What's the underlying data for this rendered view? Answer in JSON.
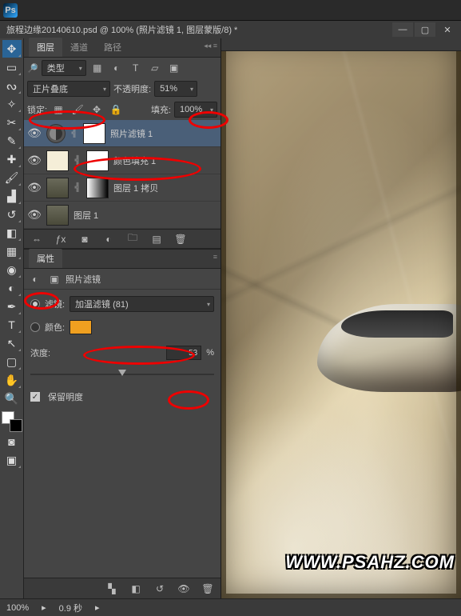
{
  "app": {
    "logo_text": "Ps"
  },
  "titlebar": {
    "text": "旅程边缘20140610.psd @ 100% (照片滤镜 1, 图层蒙版/8) *",
    "min": "—",
    "max": "▢",
    "close": "✕"
  },
  "tools": [
    "move",
    "marquee",
    "lasso",
    "wand",
    "crop",
    "eyedropper",
    "heal",
    "brush",
    "stamp",
    "history",
    "eraser",
    "gradient",
    "blur",
    "dodge",
    "pen",
    "type",
    "path",
    "rect",
    "hand",
    "zoom"
  ],
  "panels": {
    "layersTabs": {
      "t1": "图层",
      "t2": "通道",
      "t3": "路径"
    },
    "kind": {
      "label": "类型"
    },
    "blend": {
      "mode": "正片叠底",
      "opacityLabel": "不透明度:",
      "opacity": "51%"
    },
    "lock": {
      "label": "锁定:",
      "fillLabel": "填充:",
      "fill": "100%"
    },
    "layers": [
      {
        "name": "照片滤镜 1",
        "selected": true,
        "type": "adj"
      },
      {
        "name": "颜色填充 1",
        "type": "fill"
      },
      {
        "name": "图层 1 拷贝",
        "type": "img"
      },
      {
        "name": "图层 1",
        "type": "img2"
      }
    ],
    "footerIcons": [
      "fx",
      "mask",
      "adj",
      "group",
      "new",
      "trash"
    ]
  },
  "props": {
    "tab": "属性",
    "title": "照片滤镜",
    "filterLabel": "滤镜:",
    "filterValue": "加温滤镜 (81)",
    "colorLabel": "颜色:",
    "densityLabel": "浓度:",
    "densityValue": "53",
    "pct": "%",
    "preserve": "保留明度"
  },
  "watermark": "WWW.PSAHZ.COM",
  "status": {
    "zoom": "100%",
    "time": "0.9 秒"
  }
}
